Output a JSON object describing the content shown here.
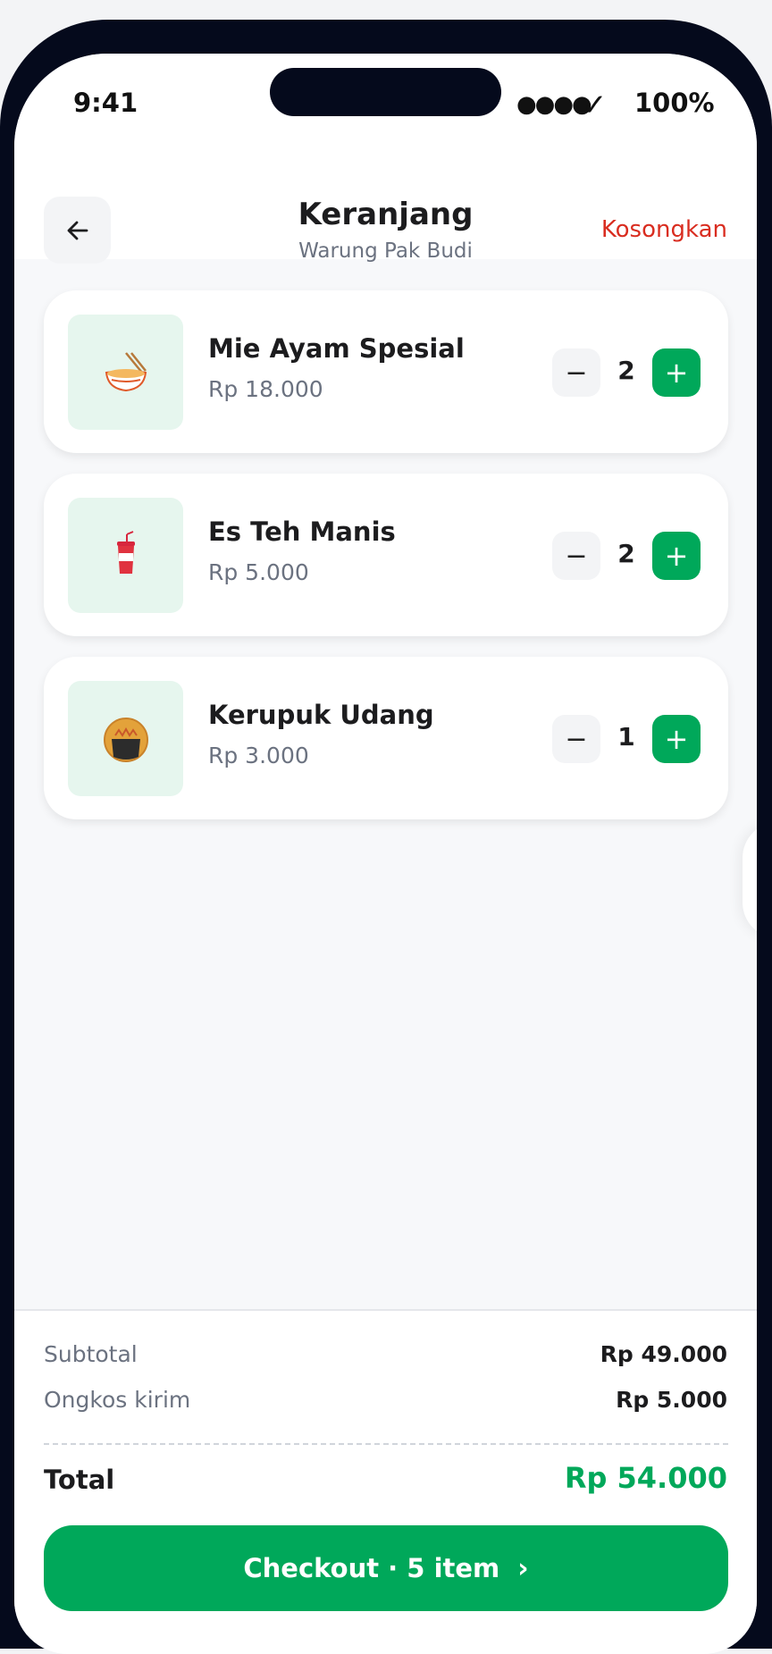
{
  "status_bar": {
    "time": "9:41",
    "signal": "●●●●",
    "battery": "100%"
  },
  "header": {
    "title": "Keranjang",
    "subtitle": "Warung Pak Budi",
    "clear_label": "Kosongkan"
  },
  "items": [
    {
      "name": "Mie Ayam Spesial",
      "price": "Rp 18.000",
      "qty": "2",
      "icon": "noodle-bowl-icon"
    },
    {
      "name": "Es Teh Manis",
      "price": "Rp 5.000",
      "qty": "2",
      "icon": "iced-drink-icon"
    },
    {
      "name": "Kerupuk Udang",
      "price": "Rp 3.000",
      "qty": "1",
      "icon": "cracker-icon"
    }
  ],
  "summary": {
    "subtotal_label": "Subtotal",
    "subtotal_value": "Rp 49.000",
    "shipping_label": "Ongkos kirim",
    "shipping_value": "Rp 5.000",
    "total_label": "Total",
    "total_value": "Rp 54.000"
  },
  "checkout": {
    "label": "Checkout · 5 item"
  },
  "colors": {
    "accent": "#00a85a",
    "danger": "#d92d20",
    "thumb_bg": "#e6f6ee"
  }
}
